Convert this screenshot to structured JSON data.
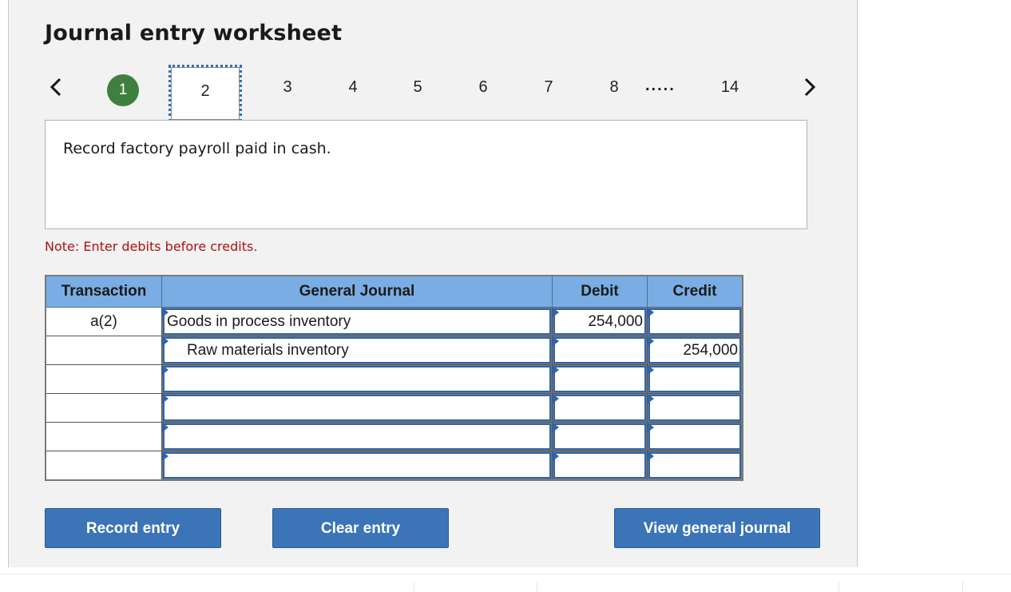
{
  "header": {
    "title": "Journal entry worksheet"
  },
  "pager": {
    "prev_icon": "chevron-left-icon",
    "next_icon": "chevron-right-icon",
    "completed_page": "1",
    "current_page": "2",
    "pages": [
      "3",
      "4",
      "5",
      "6",
      "7",
      "8"
    ],
    "ellipsis": ".....",
    "last_page": "14"
  },
  "prompt": {
    "text": "Record factory payroll paid in cash."
  },
  "note": "Note: Enter debits before credits.",
  "journal": {
    "columns": [
      "Transaction",
      "General Journal",
      "Debit",
      "Credit"
    ],
    "rows": [
      {
        "transaction": "a(2)",
        "account": "Goods in process inventory",
        "debit": "254,000",
        "credit": ""
      },
      {
        "transaction": "",
        "account": "Raw materials inventory",
        "debit": "",
        "credit": "254,000"
      },
      {
        "transaction": "",
        "account": "",
        "debit": "",
        "credit": ""
      },
      {
        "transaction": "",
        "account": "",
        "debit": "",
        "credit": ""
      },
      {
        "transaction": "",
        "account": "",
        "debit": "",
        "credit": ""
      },
      {
        "transaction": "",
        "account": "",
        "debit": "",
        "credit": ""
      }
    ]
  },
  "buttons": {
    "record": "Record entry",
    "clear": "Clear entry",
    "view": "View general journal"
  },
  "colors": {
    "completed_badge": "#3f7f3f",
    "header_fill": "#7aade3",
    "button_fill": "#3b74b7",
    "note_text": "#b30f0f",
    "field_border": "#2c66ae"
  }
}
